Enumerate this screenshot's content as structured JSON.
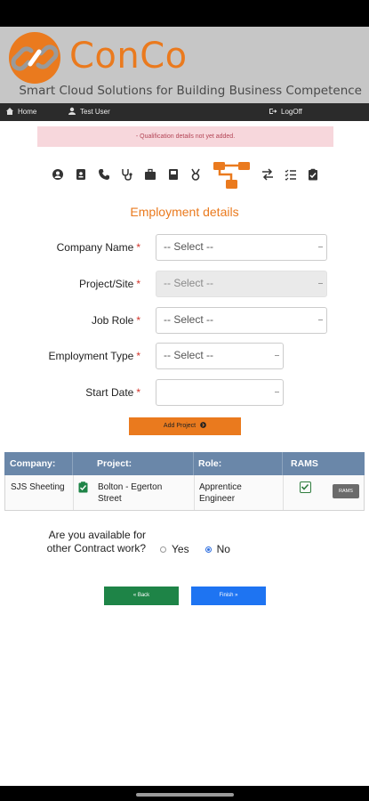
{
  "brand": {
    "name": "ConCo",
    "tagline": "Smart Cloud Solutions for Building Business Competence",
    "accent_color": "#ea7a1e"
  },
  "nav": {
    "home": "Home",
    "user": "Test User",
    "logout": "LogOff"
  },
  "alert": "- Qualification details not yet added.",
  "steps": [
    "person-icon",
    "id-card-icon",
    "phone-icon",
    "stethoscope-icon",
    "briefcase-icon",
    "book-icon",
    "medal-icon",
    "sitemap-icon",
    "exchange-icon",
    "checklist-icon",
    "clipboard-check-icon"
  ],
  "section_title": "Employment details",
  "form": {
    "company": {
      "label": "Company Name",
      "value": "-- Select --"
    },
    "project": {
      "label": "Project/Site",
      "value": "-- Select --"
    },
    "job_role": {
      "label": "Job Role",
      "value": "-- Select --"
    },
    "employment_type": {
      "label": "Employment Type",
      "value": "-- Select --"
    },
    "start_date": {
      "label": "Start Date",
      "value": ""
    },
    "required_mark": "*",
    "add_button": "Add Project"
  },
  "table": {
    "headers": [
      "Company:",
      "Project:",
      "Role:",
      "RAMS"
    ],
    "rows": [
      {
        "company": "SJS Sheeting",
        "project": "Bolton - Egerton Street",
        "role": "Apprentice Engineer",
        "rams_button": "RAMS"
      }
    ]
  },
  "contract_question": "Are you available for other Contract work?",
  "radio": {
    "yes": "Yes",
    "no": "No",
    "selected": "No"
  },
  "buttons": {
    "back": "« Back",
    "finish": "Finish »"
  }
}
